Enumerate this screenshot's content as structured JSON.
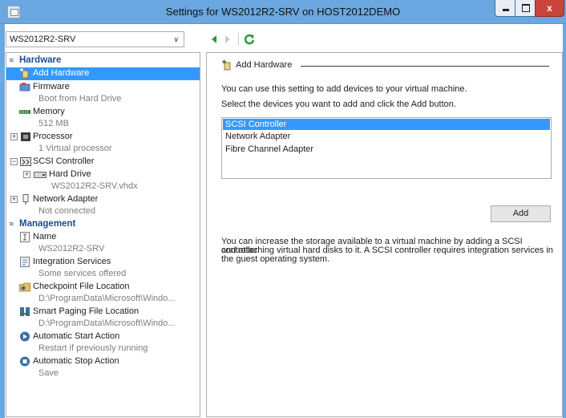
{
  "window": {
    "title": "Settings for WS2012R2-SRV on HOST2012DEMO",
    "close_glyph": "x"
  },
  "vm_selector": {
    "value": "WS2012R2-SRV",
    "arrow": "∨"
  },
  "tree": {
    "hardware_section": {
      "label": "Hardware",
      "chevron": "≈"
    },
    "items": {
      "add_hardware": {
        "label": "Add Hardware"
      },
      "firmware": {
        "label": "Firmware",
        "sub": "Boot from Hard Drive"
      },
      "memory": {
        "label": "Memory",
        "sub": "512 MB"
      },
      "processor": {
        "label": "Processor",
        "sub": "1 Virtual processor",
        "expander": "+"
      },
      "scsi": {
        "label": "SCSI Controller",
        "expander": "−"
      },
      "hard_drive": {
        "label": "Hard Drive",
        "sub": "WS2012R2-SRV.vhdx",
        "expander": "+"
      },
      "network": {
        "label": "Network Adapter",
        "sub": "Not connected",
        "expander": "+"
      }
    },
    "management_section": {
      "label": "Management",
      "chevron": "≈"
    },
    "mgmt_items": {
      "name": {
        "label": "Name",
        "sub": "WS2012R2-SRV"
      },
      "integration": {
        "label": "Integration Services",
        "sub": "Some services offered"
      },
      "checkpoint": {
        "label": "Checkpoint File Location",
        "sub": "D:\\ProgramData\\Microsoft\\Windo..."
      },
      "paging": {
        "label": "Smart Paging File Location",
        "sub": "D:\\ProgramData\\Microsoft\\Windo..."
      },
      "start": {
        "label": "Automatic Start Action",
        "sub": "Restart if previously running"
      },
      "stop": {
        "label": "Automatic Stop Action",
        "sub": "Save"
      }
    }
  },
  "pane": {
    "group_title": "Add Hardware",
    "intro": "You can use this setting to add devices to your virtual machine.",
    "instruction": "Select the devices you want to add and click the Add button.",
    "devices": [
      "SCSI Controller",
      "Network Adapter",
      "Fibre Channel Adapter"
    ],
    "selected_device": "SCSI Controller",
    "add_button": "Add",
    "info_line1": "You can increase the storage available to a virtual machine by adding a SCSI controller",
    "info_line2": "and attaching virtual hard disks to it. A SCSI controller requires integration services in",
    "info_line3": "the guest operating system."
  },
  "colors": {
    "title_bar": "#6ba7e0",
    "selection": "#3399ff",
    "section_header": "#1c4d8c",
    "close_button": "#c7453b",
    "nav_green": "#2f9a3a"
  }
}
